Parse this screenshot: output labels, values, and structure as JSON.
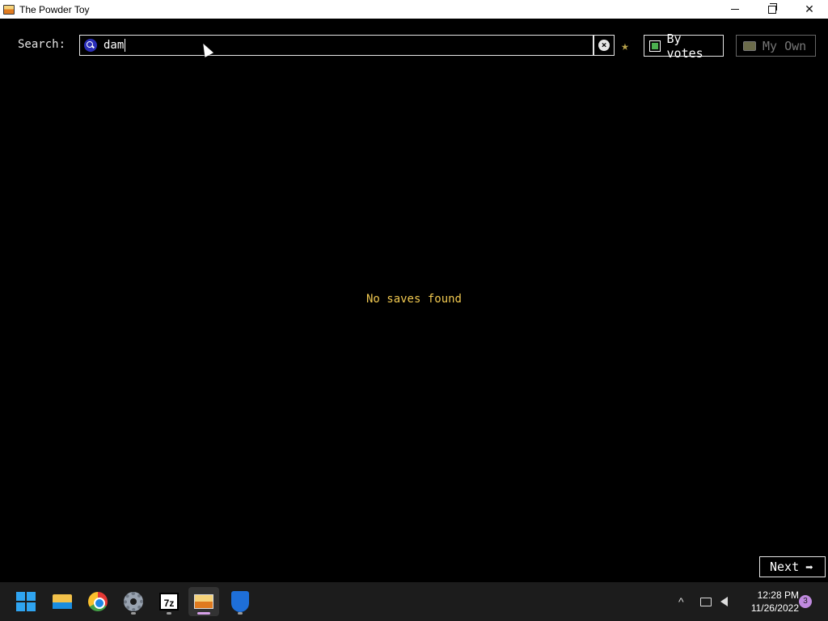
{
  "window": {
    "title": "The Powder Toy",
    "minimize_icon": "minimize-icon",
    "maximize_icon": "restore-icon",
    "close_glyph": "✕"
  },
  "search": {
    "label": "Search:",
    "value": "dam",
    "icon": "search-icon"
  },
  "toolbar": {
    "clear_glyph": "×",
    "favorite_glyph": "★",
    "sort_label": "By votes",
    "own_label": "My Own"
  },
  "results": {
    "empty_message": "No saves found"
  },
  "pagination": {
    "next_label": "Next",
    "next_glyph": "➡"
  },
  "taskbar": {
    "apps": [
      "start",
      "file-explorer",
      "chrome",
      "settings",
      "7zip",
      "the-powder-toy",
      "windows-security"
    ],
    "sevenzip_label": "7z",
    "tray_chevron": "^",
    "clock_time": "12:28 PM",
    "clock_date": "11/26/2022",
    "notification_count": "3"
  },
  "colors": {
    "accent_text": "#f0c850",
    "search_icon": "#2b2fb8",
    "taskbar": "#1c1c1c"
  }
}
